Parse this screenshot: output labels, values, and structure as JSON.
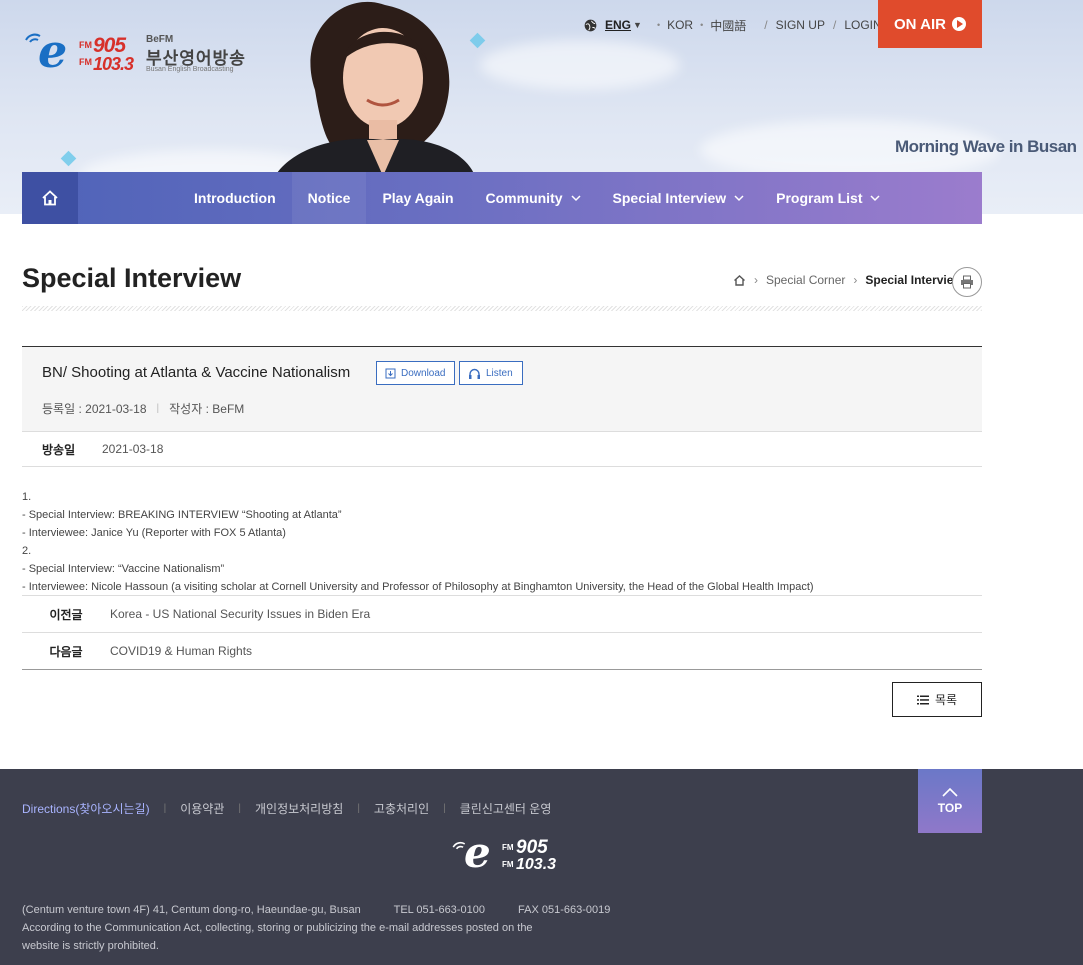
{
  "header": {
    "logo": {
      "fm_label": "FM",
      "freq1": "905",
      "freq2": "103.3",
      "brand": "BeFM",
      "korean_name": "부산영어방송",
      "subtitle": "Busan English Broadcasting"
    },
    "languages": {
      "current": "ENG",
      "kor": "KOR",
      "chinese": "中國語"
    },
    "sign_up": "SIGN UP",
    "login": "LOGIN",
    "on_air": "ON AIR",
    "tagline": "Morning Wave in Busan"
  },
  "nav": {
    "items": [
      {
        "label": "Introduction"
      },
      {
        "label": "Notice"
      },
      {
        "label": "Play Again"
      },
      {
        "label": "Community"
      },
      {
        "label": "Special Interview"
      },
      {
        "label": "Program List"
      }
    ]
  },
  "page": {
    "title": "Special Interview",
    "breadcrumb": {
      "parent": "Special Corner",
      "current": "Special Interview"
    }
  },
  "article": {
    "title": "BN/ Shooting at Atlanta & Vaccine Nationalism",
    "download_label": "Download",
    "listen_label": "Listen",
    "registered_label": "등록일 :",
    "registered_date": "2021-03-18",
    "author_label": "작성자 :",
    "author": "BeFM",
    "broadcast_label": "방송일",
    "broadcast_date": "2021-03-18",
    "content_lines": [
      "1.",
      "- Special Interview: BREAKING INTERVIEW “Shooting at Atlanta”",
      "- Interviewee: Janice Yu (Reporter with FOX 5 Atlanta)",
      "2.",
      "- Special Interview: “Vaccine Nationalism”",
      "- Interviewee: Nicole Hassoun (a visiting scholar at Cornell University and Professor of Philosophy at Binghamton University, the Head of the Global Health Impact)"
    ]
  },
  "post_nav": {
    "prev_label": "이전글",
    "prev_title": "Korea - US National Security Issues in Biden Era",
    "next_label": "다음글",
    "next_title": "COVID19 & Human Rights"
  },
  "list_button": "목록",
  "footer": {
    "links": [
      "Directions(찾아오시는길)",
      "이용약관",
      "개인정보처리방침",
      "고충처리인",
      "클린신고센터 운영"
    ],
    "logo": {
      "fm_label": "FM",
      "freq1": "905",
      "freq2": "103.3"
    },
    "address": "(Centum venture town 4F) 41, Centum dong-ro, Haeundae-gu, Busan",
    "tel": "TEL 051-663-0100",
    "fax": "FAX 051-663-0019",
    "notice_line1": "According to the Communication Act, collecting, storing or publicizing the e-mail addresses posted on the",
    "notice_line2": "website is strictly prohibited.",
    "top_label": "TOP"
  },
  "colors": {
    "accent_red": "#e04b2c",
    "nav_start": "#4e63b8",
    "nav_end": "#9b7ccd",
    "link_blue": "#3a6dc0",
    "footer_bg": "#3d3f4d"
  }
}
